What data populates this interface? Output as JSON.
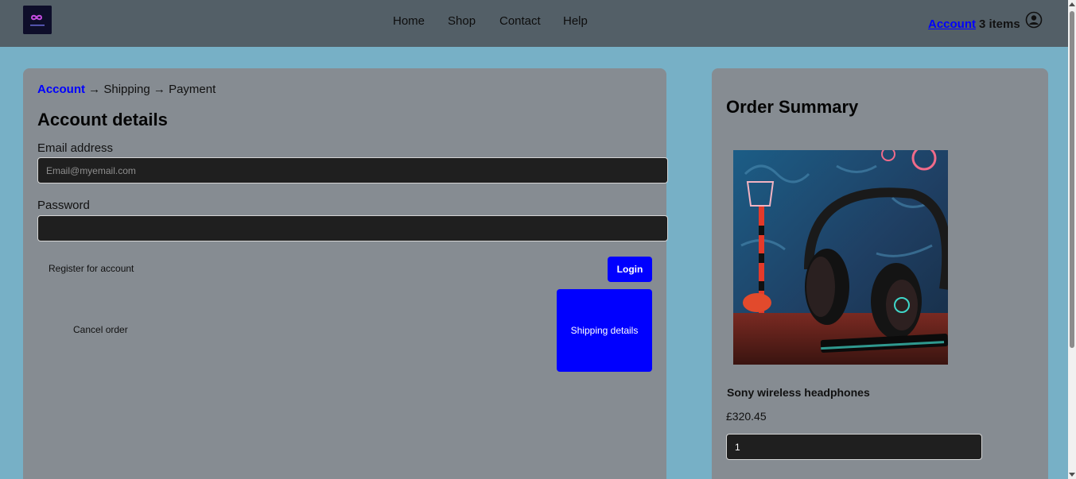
{
  "header": {
    "logo_icon": "infinity-logo-icon",
    "nav": [
      "Home",
      "Shop",
      "Contact",
      "Help"
    ],
    "account_link": "Account",
    "cart_count": "3 items",
    "user_icon": "user-circle-icon"
  },
  "checkout": {
    "breadcrumb": {
      "step1": "Account",
      "arrow": "→",
      "step2": "Shipping",
      "step3": "Payment"
    },
    "title": "Account details",
    "email": {
      "label": "Email address",
      "placeholder": "Email@myemail.com",
      "value": ""
    },
    "password": {
      "label": "Password",
      "value": ""
    },
    "register_label": "Register for account",
    "login_label": "Login",
    "cancel_label": "Cancel order",
    "shipping_label": "Shipping details"
  },
  "summary": {
    "title": "Order Summary",
    "product": {
      "name": "Sony wireless headphones",
      "price": "£320.45",
      "quantity": "1"
    }
  },
  "colors": {
    "accent": "#0000ff",
    "header_bg": "#535f67",
    "page_bg": "#77b0c6",
    "panel_bg": "#868c92"
  }
}
